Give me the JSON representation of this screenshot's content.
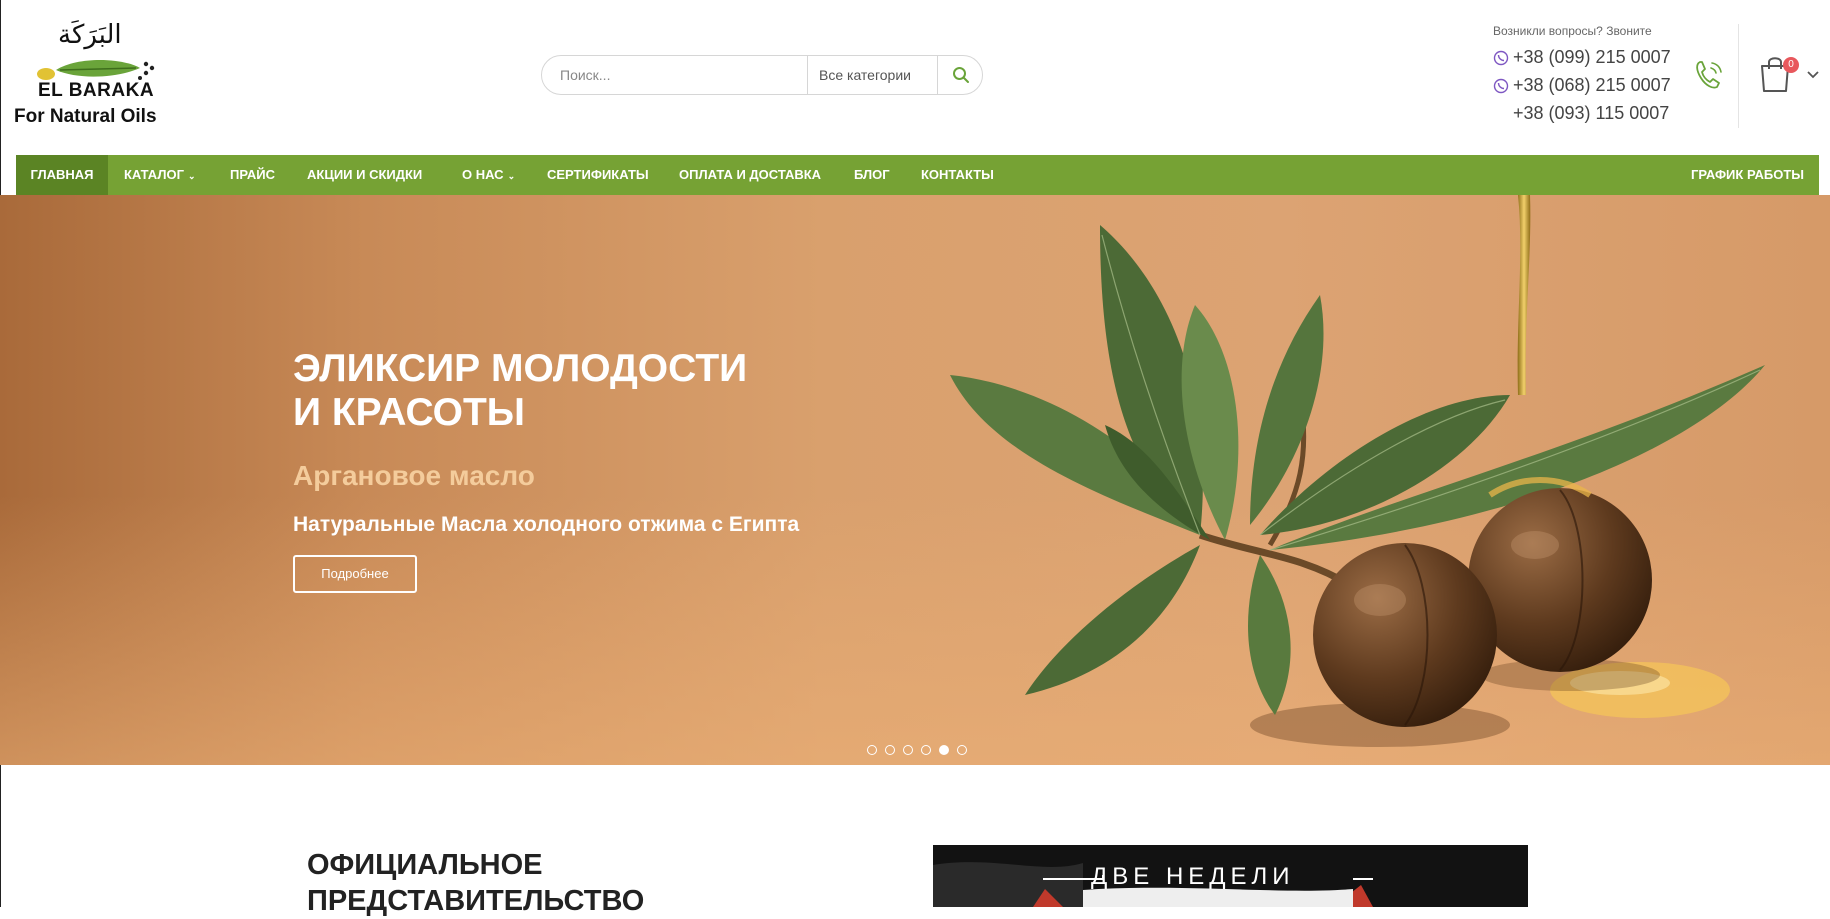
{
  "logo": {
    "arabic": "البَرَكَة",
    "line1": "EL BARAKA",
    "line2": "For Natural Oils"
  },
  "search": {
    "placeholder": "Поиск...",
    "category": "Все категории"
  },
  "contacts": {
    "question": "Возникли вопросы? Звоните",
    "phones": [
      "+38 (099) 215 0007",
      "+38 (068) 215 0007",
      "+38 (093) 115 0007"
    ]
  },
  "cart": {
    "count": "0"
  },
  "nav": {
    "items": [
      {
        "label": "ГЛАВНАЯ"
      },
      {
        "label": "КАТАЛОГ"
      },
      {
        "label": "ПРАЙС"
      },
      {
        "label": "АКЦИИ И СКИДКИ"
      },
      {
        "label": "О НАС"
      },
      {
        "label": "СЕРТИФИКАТЫ"
      },
      {
        "label": "ОПЛАТА И ДОСТАВКА"
      },
      {
        "label": "БЛОГ"
      },
      {
        "label": "КОНТАКТЫ"
      }
    ],
    "right": "ГРАФИК РАБОТЫ"
  },
  "hero": {
    "title_line1": "ЭЛИКСИР МОЛОДОСТИ",
    "title_line2": "И КРАСОТЫ",
    "subtitle": "Аргановое масло",
    "desc": "Натуральные Масла холодного отжима с Египта",
    "button": "Подробнее",
    "slides_total": 6,
    "slide_active": 5
  },
  "section": {
    "title_line1": "ОФИЦИАЛЬНОЕ",
    "title_line2": "ПРЕДСТАВИТЕЛЬСТВО"
  },
  "promo": {
    "text": "ДВЕ НЕДЕЛИ"
  },
  "colors": {
    "nav_green": "#76a234",
    "nav_active": "#5b8424",
    "accent_green": "#6aa43a",
    "badge_red": "#e8585d"
  }
}
